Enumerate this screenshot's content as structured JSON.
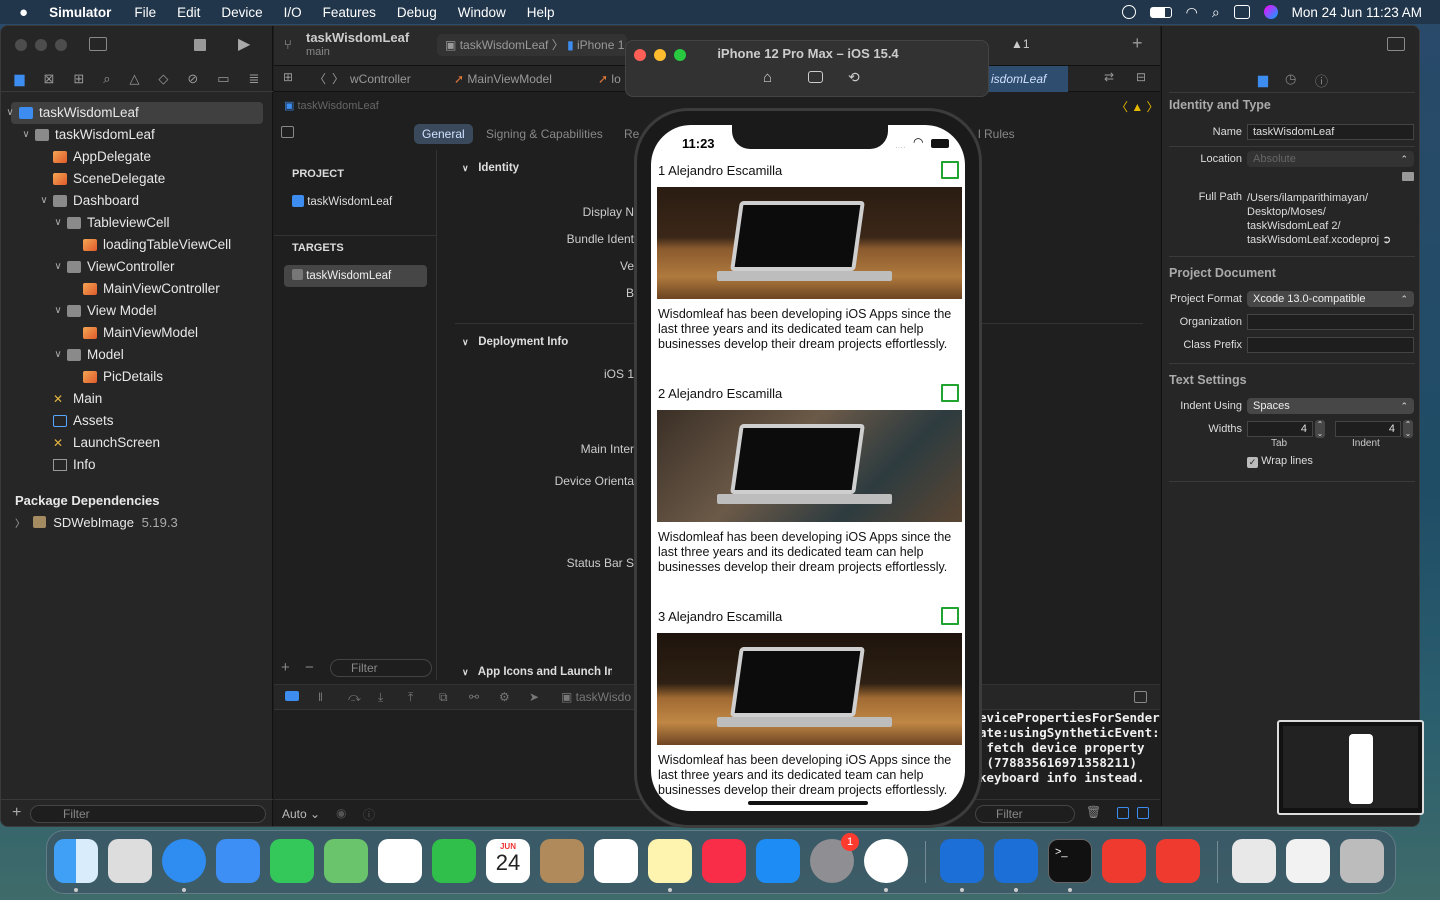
{
  "menubar": {
    "app": "Simulator",
    "items": [
      "File",
      "Edit",
      "Device",
      "I/O",
      "Features",
      "Debug",
      "Window",
      "Help"
    ],
    "datetime": "Mon 24 Jun  11:23 AM"
  },
  "xcode": {
    "scheme_title": "taskWisdomLeaf",
    "scheme_sub": "main",
    "run_dest": "taskWisdomLeaf",
    "run_device": "iPhone 1",
    "warnings": "1",
    "tabs": [
      "wController",
      "MainViewModel",
      "lo",
      "isdomLeaf"
    ],
    "jump": "taskWisdomLeaf",
    "navigator": {
      "tree": [
        {
          "label": "taskWisdomLeaf",
          "level": 0,
          "icon": "project-icon",
          "expanded": true,
          "selected": true
        },
        {
          "label": "taskWisdomLeaf",
          "level": 1,
          "icon": "folder-icon",
          "expanded": true
        },
        {
          "label": "AppDelegate",
          "level": 2,
          "icon": "swift-file-icon"
        },
        {
          "label": "SceneDelegate",
          "level": 2,
          "icon": "swift-file-icon"
        },
        {
          "label": "Dashboard",
          "level": 2,
          "icon": "folder-icon",
          "expanded": true
        },
        {
          "label": "TableviewCell",
          "level": 3,
          "icon": "folder-icon",
          "expanded": true
        },
        {
          "label": "loadingTableViewCell",
          "level": 4,
          "icon": "swift-file-icon"
        },
        {
          "label": "ViewController",
          "level": 3,
          "icon": "folder-icon",
          "expanded": true
        },
        {
          "label": "MainViewController",
          "level": 4,
          "icon": "swift-file-icon"
        },
        {
          "label": "View Model",
          "level": 3,
          "icon": "folder-icon",
          "expanded": true
        },
        {
          "label": "MainViewModel",
          "level": 4,
          "icon": "swift-file-icon"
        },
        {
          "label": "Model",
          "level": 3,
          "icon": "folder-icon",
          "expanded": true
        },
        {
          "label": "PicDetails",
          "level": 4,
          "icon": "swift-file-icon"
        },
        {
          "label": "Main",
          "level": 2,
          "icon": "storyboard-icon"
        },
        {
          "label": "Assets",
          "level": 2,
          "icon": "assets-icon"
        },
        {
          "label": "LaunchScreen",
          "level": 2,
          "icon": "storyboard-icon"
        },
        {
          "label": "Info",
          "level": 2,
          "icon": "plist-icon"
        }
      ],
      "pkg_header": "Package Dependencies",
      "pkg_name": "SDWebImage",
      "pkg_version": "5.19.3",
      "filter_placeholder": "Filter"
    },
    "editor": {
      "subtabs": [
        "General",
        "Signing & Capabilities",
        "Re",
        "l Rules"
      ],
      "project_header": "PROJECT",
      "project_item": "taskWisdomLeaf",
      "targets_header": "TARGETS",
      "target_item": "taskWisdomLeaf",
      "identity": "Identity",
      "display_name": "Display N",
      "bundle_ident": "Bundle Ident",
      "version": "Ve",
      "build": "B",
      "deployment": "Deployment Info",
      "ios": "iOS 1",
      "main_interface": "Main Inter",
      "device_orient": "Device Orienta",
      "status_bar": "Status Bar S",
      "app_icons": "App Icons and Launch Imag",
      "filter_placeholder": "Filter",
      "debug_target": "taskWisdo",
      "auto": "Auto ⌄",
      "console": "evicePropertiesForSender\nate:usingSyntheticEvent:\n fetch device property\n (778835616971358211)\nkeyboard info instead.",
      "console_filter": "Filter"
    },
    "inspector": {
      "identity_header": "Identity and Type",
      "name_label": "Name",
      "name_value": "taskWisdomLeaf",
      "location_label": "Location",
      "location_value": "Absolute",
      "fullpath_label": "Full Path",
      "fullpath_lines": [
        "/Users/ilamparithimayan/",
        "Desktop/Moses/",
        "taskWisdomLeaf 2/",
        "taskWisdomLeaf.xcodeproj"
      ],
      "projdoc_header": "Project Document",
      "format_label": "Project Format",
      "format_value": "Xcode 13.0-compatible",
      "org_label": "Organization",
      "prefix_label": "Class Prefix",
      "text_header": "Text Settings",
      "indent_label": "Indent Using",
      "indent_value": "Spaces",
      "widths_label": "Widths",
      "tab_value": "4",
      "indent_width": "4",
      "tab_label": "Tab",
      "indent_sub": "Indent",
      "wrap_label": "Wrap lines"
    }
  },
  "simulator": {
    "title": "iPhone 12 Pro Max – iOS 15.4",
    "time": "11:23",
    "cells": [
      {
        "title": "1 Alejandro Escamilla",
        "desc": "Wisdomleaf has been developing iOS Apps since the last three years and its dedicated team can help businesses develop their dream projects effortlessly."
      },
      {
        "title": "2 Alejandro Escamilla",
        "desc": "Wisdomleaf has been developing iOS Apps since the last three years and its dedicated team can help businesses develop their dream projects effortlessly."
      },
      {
        "title": "3 Alejandro Escamilla",
        "desc": "Wisdomleaf has been developing iOS Apps since the last three years and its dedicated team can help businesses develop their dream projects effortlessly."
      }
    ]
  },
  "dock": {
    "calendar_month": "JUN",
    "calendar_day": "24",
    "settings_badge": "1",
    "apps": [
      "finder-icon",
      "launchpad-icon",
      "safari-icon",
      "mail-icon",
      "messages-icon",
      "maps-icon",
      "photos-icon",
      "facetime-icon",
      "calendar-icon",
      "contacts-icon",
      "reminders-icon",
      "notes-icon",
      "music-icon",
      "appstore-icon",
      "system-preferences-icon",
      "chrome-icon",
      "xcode-icon",
      "xcode-beta-icon",
      "terminal-icon",
      "anydesk-icon",
      "anydesk-icon",
      "archive-icon",
      "downloads-icon",
      "trash-icon"
    ],
    "colors": {
      "accent": "#3d8cf0",
      "check_green": "#21a32f"
    }
  }
}
